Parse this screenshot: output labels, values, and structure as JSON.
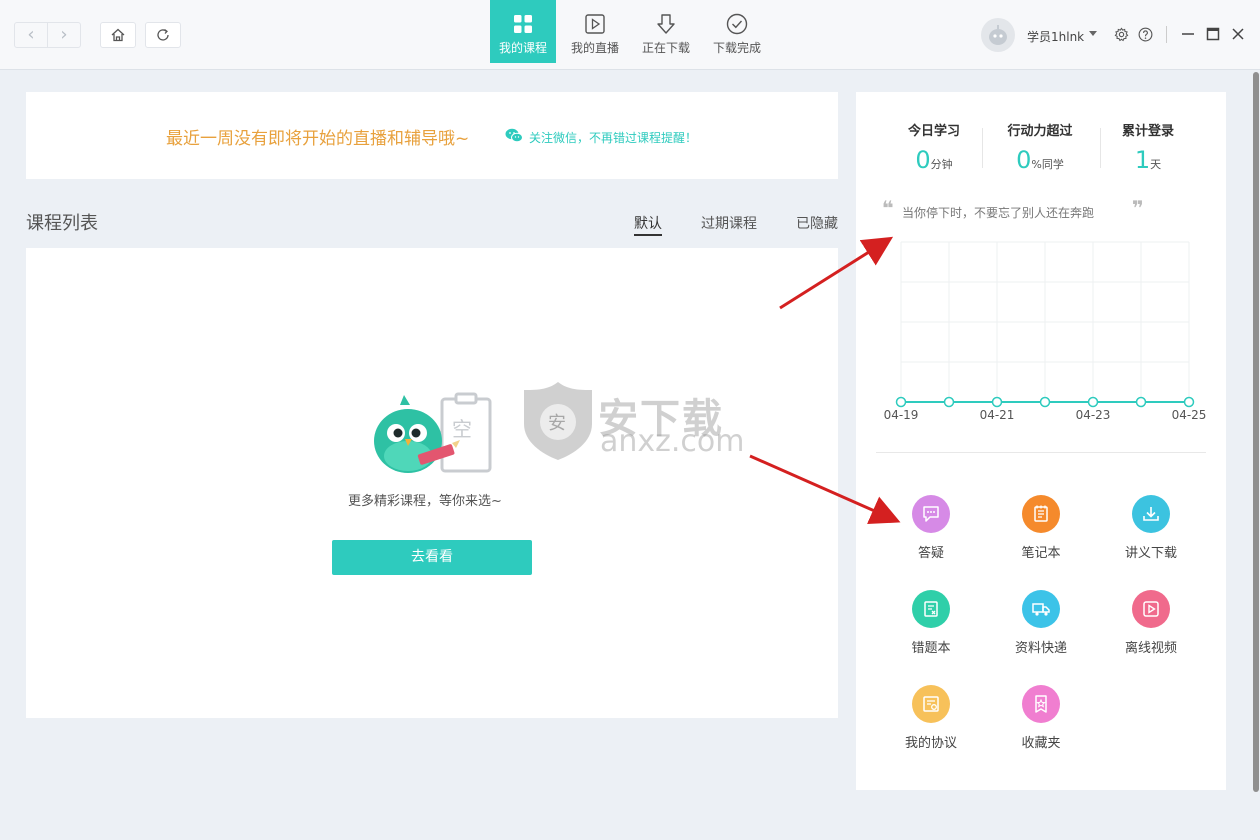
{
  "header": {
    "tabs": [
      {
        "label": "我的课程",
        "icon": "grid-icon",
        "active": true
      },
      {
        "label": "我的直播",
        "icon": "live-play-icon",
        "active": false
      },
      {
        "label": "正在下载",
        "icon": "download-arrow-icon",
        "active": false
      },
      {
        "label": "下载完成",
        "icon": "check-circle-icon",
        "active": false
      }
    ],
    "username": "学员1hlnk",
    "accent_color": "#2ecbbe"
  },
  "notice": {
    "message": "最近一周没有即将开始的直播和辅导哦~",
    "wechat_hint": "关注微信，不再错过课程提醒！"
  },
  "courses": {
    "title": "课程列表",
    "filters": [
      "默认",
      "过期课程",
      "已隐藏"
    ],
    "active_filter": "默认",
    "empty_illustration_text": "空",
    "empty_text": "更多精彩课程，等你来选~",
    "go_button": "去看看"
  },
  "watermark": {
    "text": "安下载",
    "sub": "anxz.com",
    "shield_char": "安"
  },
  "side": {
    "stats": [
      {
        "label": "今日学习",
        "value": "0",
        "unit": "分钟"
      },
      {
        "label": "行动力超过",
        "value": "0",
        "unit": "%同学"
      },
      {
        "label": "累计登录",
        "value": "1",
        "unit": "天"
      }
    ],
    "quote": "当你停下时，不要忘了别人还在奔跑",
    "chart_data": {
      "type": "line",
      "x": [
        "04-19",
        "04-20",
        "04-21",
        "04-22",
        "04-23",
        "04-24",
        "04-25"
      ],
      "x_tick_labels": [
        "04-19",
        "04-21",
        "04-23",
        "04-25"
      ],
      "series": [
        {
          "values": [
            0,
            0,
            0,
            0,
            0,
            0,
            0
          ]
        }
      ],
      "grid": true,
      "color": "#2ecbbe"
    },
    "tools": [
      {
        "label": "答疑",
        "icon": "chat-bubble-icon",
        "color": "#d68ae6"
      },
      {
        "label": "笔记本",
        "icon": "notebook-icon",
        "color": "#f58a2c"
      },
      {
        "label": "讲义下载",
        "icon": "download-tray-icon",
        "color": "#3cc3e0"
      },
      {
        "label": "错题本",
        "icon": "wrong-book-icon",
        "color": "#2fcfa9"
      },
      {
        "label": "资料快递",
        "icon": "truck-icon",
        "color": "#3cc3e8"
      },
      {
        "label": "离线视频",
        "icon": "video-play-icon",
        "color": "#f06a8c"
      },
      {
        "label": "我的协议",
        "icon": "agreement-icon",
        "color": "#f7c15a"
      },
      {
        "label": "收藏夹",
        "icon": "favorite-star-icon",
        "color": "#f07ed0"
      }
    ]
  }
}
